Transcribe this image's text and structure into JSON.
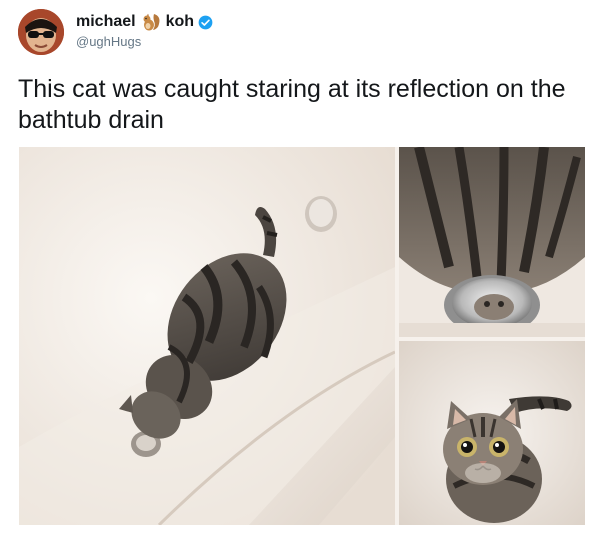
{
  "author": {
    "display_name_first": "michael",
    "display_name_last": "koh",
    "handle": "@ughHugs"
  },
  "tweet": {
    "text": "This cat was caught staring at its reflection on the bathtub drain"
  },
  "icons": {
    "avatar": "avatar-photo",
    "emoji": "squirrel-icon",
    "verified": "verified-badge-icon"
  },
  "colors": {
    "verified": "#1da1f2",
    "handle": "#657786",
    "text": "#14171a"
  }
}
